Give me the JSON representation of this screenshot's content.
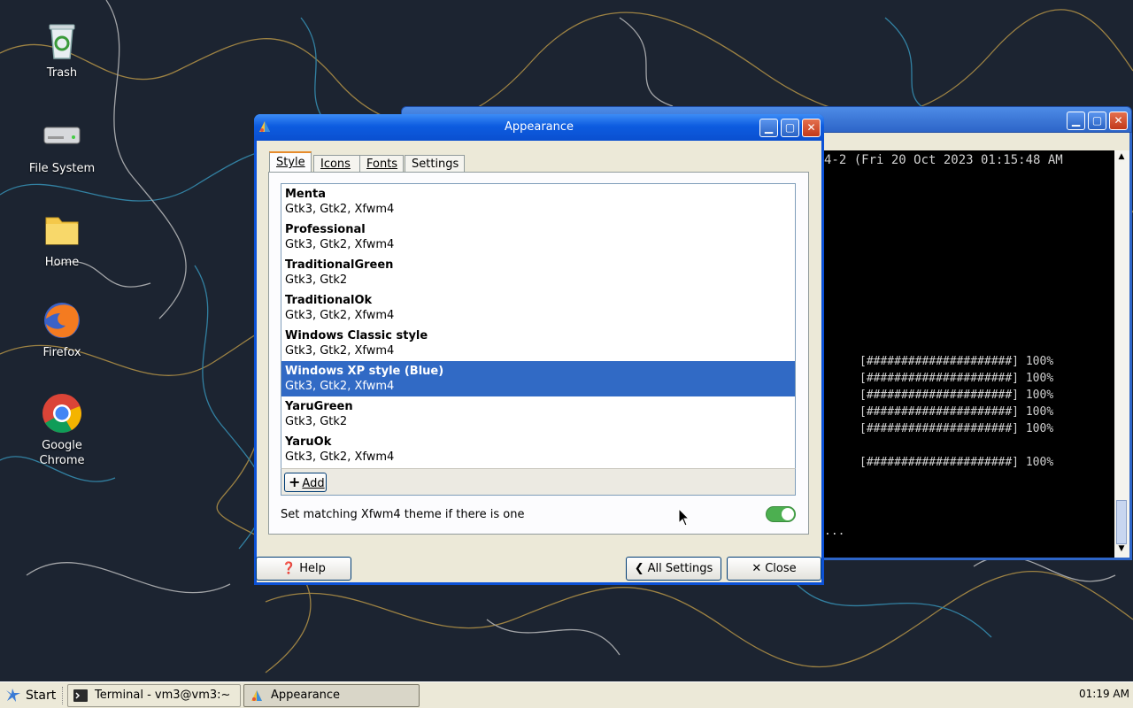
{
  "desktop": {
    "icons": [
      {
        "label": "Trash",
        "icon": "trash-icon"
      },
      {
        "label": "File System",
        "icon": "drive-icon"
      },
      {
        "label": "Home",
        "icon": "folder-icon"
      },
      {
        "label": "Firefox",
        "icon": "firefox-icon"
      },
      {
        "label": "Google\nChrome",
        "icon": "chrome-icon"
      }
    ]
  },
  "terminal": {
    "line1": "4-2 (Fri 20 Oct 2023 01:15:48 AM",
    "progress_lines": [
      "[#####################] 100%",
      "[#####################] 100%",
      "[#####################] 100%",
      "[#####################] 100%",
      "[#####################] 100%",
      "",
      "[#####################] 100%"
    ],
    "ellipsis": "..."
  },
  "dialog": {
    "title": "Appearance",
    "tabs": [
      {
        "label": "Style",
        "active": true
      },
      {
        "label": "Icons",
        "active": false
      },
      {
        "label": "Fonts",
        "active": false
      },
      {
        "label": "Settings",
        "active": false
      }
    ],
    "themes": [
      {
        "name": "Menta",
        "sub": "Gtk3, Gtk2, Xfwm4"
      },
      {
        "name": "Professional",
        "sub": "Gtk3, Gtk2, Xfwm4"
      },
      {
        "name": "TraditionalGreen",
        "sub": "Gtk3, Gtk2"
      },
      {
        "name": "TraditionalOk",
        "sub": "Gtk3, Gtk2, Xfwm4"
      },
      {
        "name": "Windows Classic style",
        "sub": "Gtk3, Gtk2, Xfwm4"
      },
      {
        "name": "Windows XP style (Blue)",
        "sub": "Gtk3, Gtk2, Xfwm4",
        "selected": true
      },
      {
        "name": "YaruGreen",
        "sub": "Gtk3, Gtk2"
      },
      {
        "name": "YaruOk",
        "sub": "Gtk3, Gtk2, Xfwm4"
      }
    ],
    "add_label": "Add",
    "match_label": "Set matching Xfwm4 theme if there is one",
    "match_enabled": true,
    "help_label": "Help",
    "all_settings_label": "All Settings",
    "close_label": "Close"
  },
  "taskbar": {
    "start_label": "Start",
    "tasks": [
      {
        "label": "Terminal - vm3@vm3:~",
        "icon": "terminal-icon",
        "active": false
      },
      {
        "label": "Appearance",
        "icon": "appearance-icon",
        "active": true
      }
    ],
    "clock": "01:19 AM"
  },
  "colors": {
    "selection": "#316ac5",
    "titlebar": "#0a4fd0",
    "toggle_on": "#4caf50"
  }
}
